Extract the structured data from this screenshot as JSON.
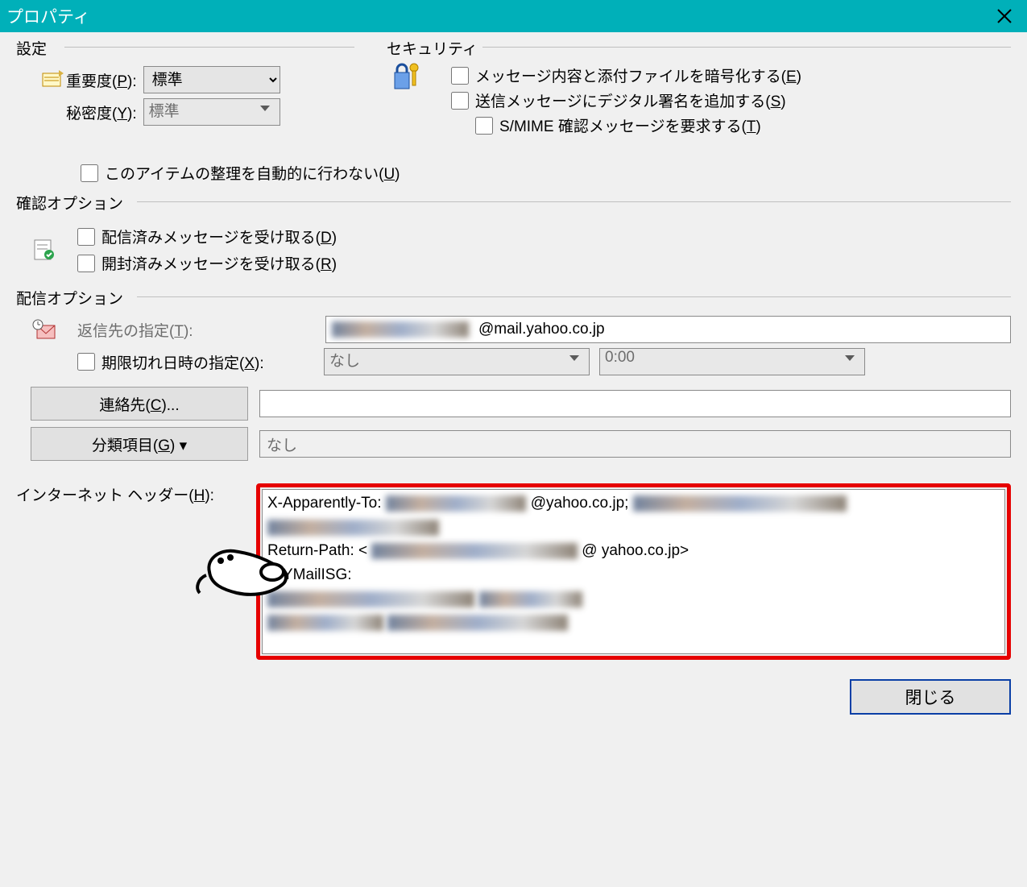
{
  "window": {
    "title": "プロパティ"
  },
  "settings": {
    "legend": "設定",
    "importance_label_pre": "重要度(",
    "importance_key": "P",
    "importance_label_post": "):",
    "importance_value": "標準",
    "sensitivity_label_pre": "秘密度(",
    "sensitivity_key": "Y",
    "sensitivity_label_post": "):",
    "sensitivity_value": "標準"
  },
  "security": {
    "legend": "セキュリティ",
    "encrypt_pre": "メッセージ内容と添付ファイルを暗号化する(",
    "encrypt_key": "E",
    "sign_pre": "送信メッセージにデジタル署名を追加する(",
    "sign_key": "S",
    "smime_pre": "S/MIME 確認メッセージを要求する(",
    "smime_key": "T"
  },
  "auto_sort": {
    "label_pre": "このアイテムの整理を自動的に行わない(",
    "label_key": "U",
    "label_post": ")"
  },
  "confirm": {
    "legend": "確認オプション",
    "delivery_pre": "配信済みメッセージを受け取る(",
    "delivery_key": "D",
    "read_pre": "開封済みメッセージを受け取る(",
    "read_key": "R"
  },
  "delivery": {
    "legend": "配信オプション",
    "replyto_label_pre": "返信先の指定(",
    "replyto_key": "T",
    "replyto_value_visible": "@mail.yahoo.co.jp",
    "expire_label_pre": "期限切れ日時の指定(",
    "expire_key": "X",
    "expire_date_value": "なし",
    "expire_time_value": "0:00",
    "contacts_btn_pre": "連絡先(",
    "contacts_btn_key": "C",
    "contacts_btn_post": ")...",
    "contacts_value": "",
    "category_btn_pre": "分類項目(",
    "category_btn_key": "G",
    "category_btn_post": ")",
    "category_value": "なし"
  },
  "headers": {
    "label_pre": "インターネット ヘッダー(",
    "label_key": "H",
    "label_post": "):",
    "lines": [
      {
        "prefix": "X-Apparently-To:",
        "redacted_before": true,
        "visible": "@yahoo.co.jp;",
        "redacted_after": true
      },
      {
        "prefix": "",
        "redacted_before": true,
        "visible": "",
        "redacted_after": false
      },
      {
        "prefix": "Return-Path: <",
        "redacted_before": true,
        "visible": "@   yahoo.co.jp>",
        "redacted_after": false
      },
      {
        "prefix": "X-YMailISG:",
        "redacted_before": false,
        "visible": "",
        "redacted_after": false
      },
      {
        "prefix": "",
        "redacted_before": true,
        "visible": "",
        "redacted_after": true
      },
      {
        "prefix": "",
        "redacted_before": true,
        "visible": "",
        "redacted_after": true
      }
    ]
  },
  "footer": {
    "close_label": "閉じる"
  }
}
